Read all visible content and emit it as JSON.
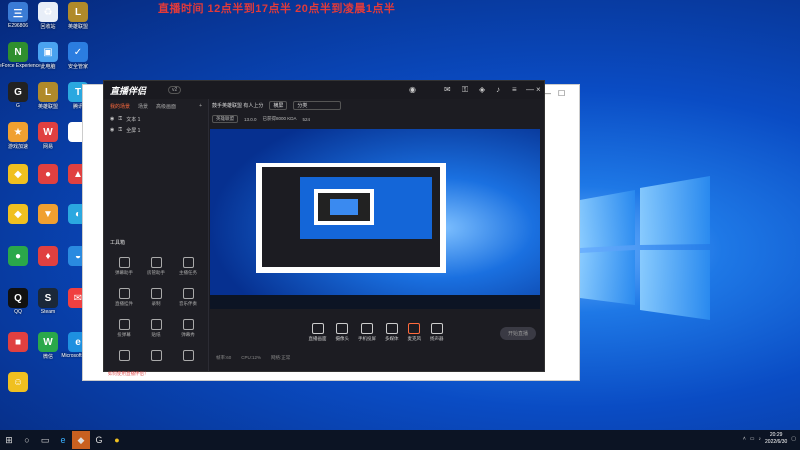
{
  "banner": "直播时间 12点半到17点半  20点半到凌晨1点半",
  "desktop_icons": [
    {
      "label": "E296806",
      "color": "#3a7bd5",
      "glyph": "三"
    },
    {
      "label": "回收站",
      "color": "#e8eef8",
      "glyph": "♻"
    },
    {
      "label": "英雄联盟",
      "color": "#b08a2a",
      "glyph": "L"
    },
    {
      "label": "GeForce Experience",
      "color": "#2f8f2f",
      "glyph": "N"
    },
    {
      "label": "此电脑",
      "color": "#4aa3f0",
      "glyph": "▣"
    },
    {
      "label": "安全管家",
      "color": "#2b7de0",
      "glyph": "✓"
    },
    {
      "label": "G",
      "color": "#222",
      "glyph": "G"
    },
    {
      "label": "英雄联盟",
      "color": "#b08a2a",
      "glyph": "L"
    },
    {
      "label": "腾讯",
      "color": "#2aa8e0",
      "glyph": "T"
    },
    {
      "label": "游戏加速",
      "color": "#f0a030",
      "glyph": "★"
    },
    {
      "label": "网易",
      "color": "#e04040",
      "glyph": "W"
    },
    {
      "label": "",
      "color": "#ffffff",
      "glyph": "■"
    },
    {
      "label": "",
      "color": "#f0c020",
      "glyph": "◆"
    },
    {
      "label": "",
      "color": "#e04040",
      "glyph": "●"
    },
    {
      "label": "",
      "color": "#e04040",
      "glyph": "▲"
    },
    {
      "label": "",
      "color": "#f0c020",
      "glyph": "◆"
    },
    {
      "label": "",
      "color": "#f0a030",
      "glyph": "▼"
    },
    {
      "label": "",
      "color": "#2aa8e0",
      "glyph": "◐"
    },
    {
      "label": "",
      "color": "#2aa84a",
      "glyph": "●"
    },
    {
      "label": "",
      "color": "#e04040",
      "glyph": "♦"
    },
    {
      "label": "",
      "color": "#2a8ae0",
      "glyph": "◒"
    },
    {
      "label": "QQ",
      "color": "#111",
      "glyph": "Q"
    },
    {
      "label": "Steam",
      "color": "#1b2838",
      "glyph": "S"
    },
    {
      "label": "",
      "color": "#f04040",
      "glyph": "✉"
    },
    {
      "label": "",
      "color": "#e04040",
      "glyph": "■"
    },
    {
      "label": "微信",
      "color": "#2aa84a",
      "glyph": "W"
    },
    {
      "label": "Microsoft Edge",
      "color": "#1e90e0",
      "glyph": "e"
    },
    {
      "label": "",
      "color": "#f0c020",
      "glyph": "☺"
    }
  ],
  "app": {
    "logo": "直播伴侣",
    "version": "v2",
    "tabs": [
      "我的场景",
      "场景",
      "高级画面"
    ],
    "scenes": [
      "文本 1",
      "全屏 1"
    ],
    "tools_header": "工具箱",
    "tools": [
      "弹幕助手",
      "房管助手",
      "主播任务",
      "直播挂件",
      "录制",
      "音乐伴奏",
      "投弹幕",
      "贴纸",
      "弹幕秀",
      "",
      "",
      ""
    ],
    "notice": "如何使用直播伴侣！",
    "info_title": "鼓手英雄联盟 有人上分",
    "info_chip1": "横屏",
    "info_chip2": "分类",
    "info_row2": [
      "英雄联盟",
      "13.0.0",
      "已获得8000 KDA",
      "524"
    ],
    "bottom_buttons": [
      "直播画面",
      "摄像头",
      "手机投屏",
      "多媒体",
      "麦克风",
      "扬声器"
    ],
    "golive": "开始直播",
    "status": [
      "帧率:60",
      "CPU:12%",
      "网络:正常"
    ]
  },
  "taskbar": {
    "time": "20:29",
    "date": "2022/6/30"
  }
}
